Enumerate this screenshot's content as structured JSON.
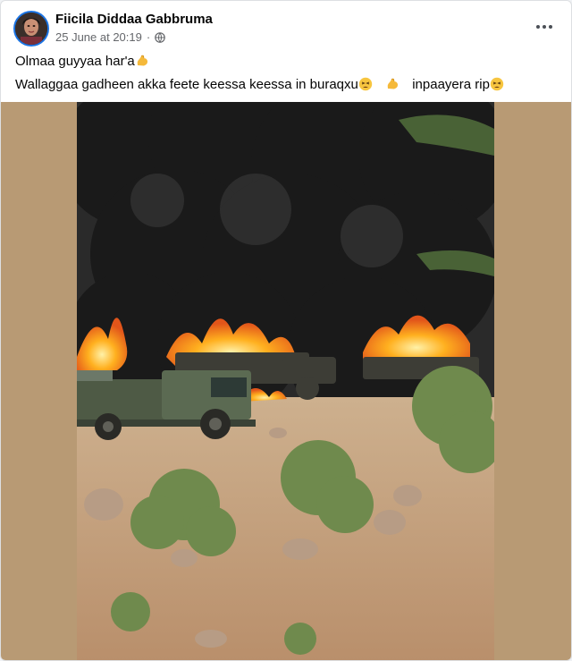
{
  "post": {
    "author": "Fiicila Diddaa Gabbruma",
    "date": "25 June at 20:19",
    "separator": "·",
    "privacy_icon": "globe-icon",
    "more_icon": "more-options-icon",
    "text_line_1": "Olmaa guyyaa har'a",
    "text_line_2_part_1": "Wallaggaa gadheen akka feete keessa  keessa in buraqxu",
    "text_line_2_part_2": "inpaayera rip",
    "emojis": [
      "flexed-biceps-emoji",
      "tired-face-emoji",
      "flexed-biceps-emoji",
      "tired-face-emoji"
    ]
  },
  "photo": {
    "subject_icon": "burning-trucks-photo"
  },
  "colors": {
    "author_text": "#050505",
    "meta_text": "#65676b",
    "avatar_ring": "#1b74e4",
    "photo_backdrop": "#b89a74"
  }
}
